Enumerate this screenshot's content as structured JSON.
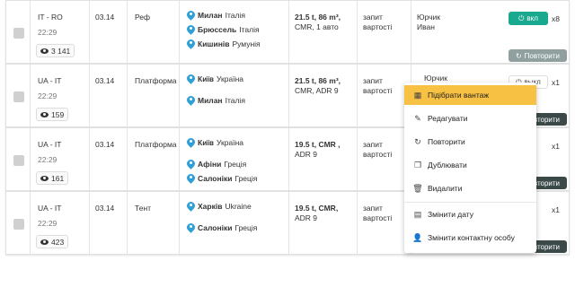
{
  "rows": [
    {
      "route": "IT - RO",
      "time": "22:29",
      "views": "3 141",
      "date": "03.14",
      "body": "Реф",
      "cities": [
        {
          "city": "Милан",
          "country": "Італія"
        },
        {
          "city": "Брюссель",
          "country": "Італія"
        },
        {
          "city": "Кишинів",
          "country": "Румунія"
        }
      ],
      "cargo_main": "21.5 t, 86 m³,",
      "cargo_sub": "CMR, 1 авто",
      "price": [
        "запит",
        "вартості"
      ],
      "contact": [
        "Юрчик",
        "Иван"
      ],
      "toggle": "вкл",
      "count": "x8",
      "repeat": "Повторити"
    },
    {
      "route": "UA - IT",
      "time": "22:29",
      "views": "159",
      "date": "03.14",
      "body": "Платформа",
      "cities": [
        {
          "city": "Київ",
          "country": "Україна"
        },
        {
          "city": "Милан",
          "country": "Італія"
        }
      ],
      "cargo_main": "21.5 t, 86 m³,",
      "cargo_sub": "CMR, ADR 9",
      "price": [
        "запит",
        "вартості"
      ],
      "contact": [
        "Юрчик",
        ""
      ],
      "toggle": "выкл",
      "count": "x1",
      "repeat": "Повторити"
    },
    {
      "route": "UA - IT",
      "time": "22:29",
      "views": "161",
      "date": "03.14",
      "body": "Платформа",
      "cities": [
        {
          "city": "Київ",
          "country": "Україна"
        },
        {
          "city": "Афіни",
          "country": "Греція"
        },
        {
          "city": "Салоніки",
          "country": "Греція"
        }
      ],
      "cargo_main": "19.5 t, CMR ,",
      "cargo_sub": "ADR 9",
      "price": [
        "запит",
        "вартості"
      ],
      "contact": [
        "",
        ""
      ],
      "toggle": "",
      "count": "x1",
      "repeat": "Повторити"
    },
    {
      "route": "UA - IT",
      "time": "22:29",
      "views": "423",
      "date": "03.14",
      "body": "Тент",
      "cities": [
        {
          "city": "Харків",
          "country": "Ukraine"
        },
        {
          "city": "Салоніки",
          "country": "Греція"
        }
      ],
      "cargo_main": "19.5 t, CMR,",
      "cargo_sub": "ADR 9",
      "price": [
        "запит",
        "вартості"
      ],
      "contact": [
        "",
        ""
      ],
      "toggle": "",
      "count": "x1",
      "repeat": "Повторити"
    }
  ],
  "menu": {
    "items": [
      {
        "label": "Підібрати вантаж",
        "icon": "truck-search-icon"
      },
      {
        "label": "Редагувати",
        "icon": "pencil-icon"
      },
      {
        "label": "Повторити",
        "icon": "refresh-icon"
      },
      {
        "label": "Дублювати",
        "icon": "copy-icon"
      },
      {
        "label": "Видалити",
        "icon": "trash-icon"
      },
      {
        "label": "Змінити дату",
        "icon": "calendar-icon"
      },
      {
        "label": "Змінити контактну особу",
        "icon": "user-edit-icon"
      }
    ]
  },
  "colors": {
    "accent": "#19a98f",
    "highlight": "#f7c143",
    "pin": "#2f9fd8",
    "repeat_btn": "#8fa09e",
    "repeat_btn_dark": "#3b4a48"
  }
}
